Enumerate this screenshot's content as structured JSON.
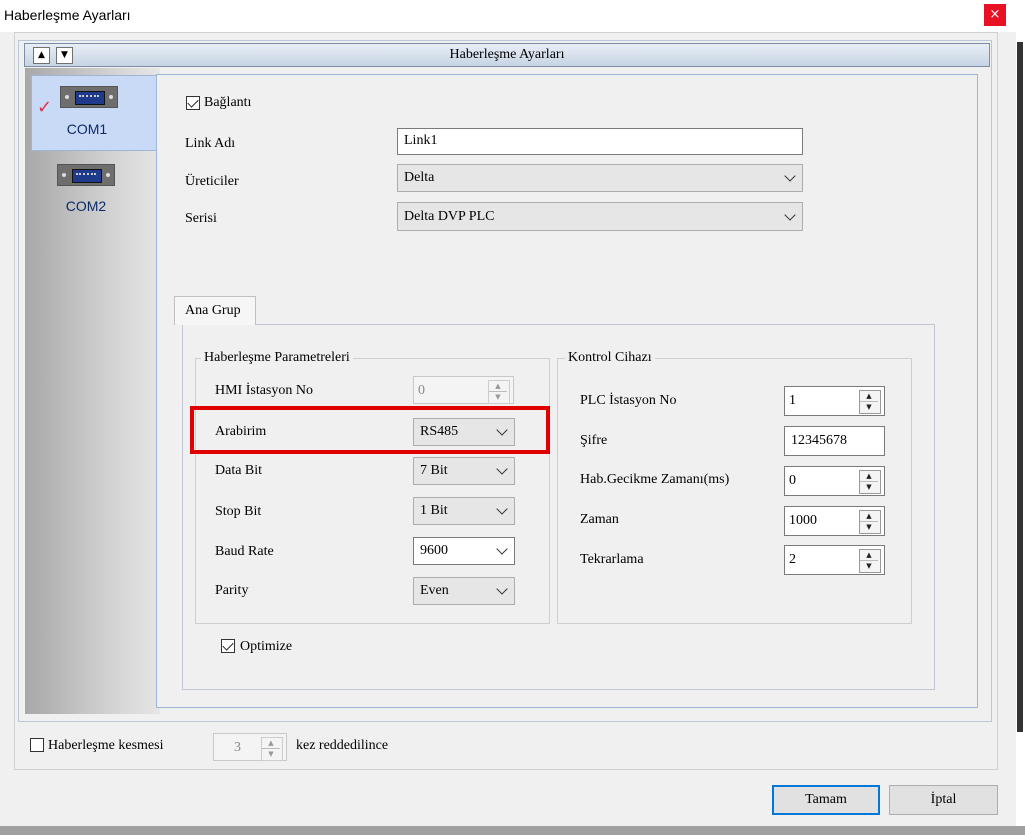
{
  "window": {
    "title": "Haberleşme Ayarları",
    "close_glyph": "×"
  },
  "header": {
    "title": "Haberleşme Ayarları",
    "up_glyph": "▲",
    "down_glyph": "▼"
  },
  "ports": [
    {
      "label": "COM1",
      "active": true,
      "check_glyph": "✓"
    },
    {
      "label": "COM2",
      "active": false
    }
  ],
  "connection": {
    "enabled_label": "Bağlantı",
    "enabled": true,
    "link_name_label": "Link Adı",
    "link_name_value": "Link1",
    "manufacturer_label": "Üreticiler",
    "manufacturer_value": "Delta",
    "series_label": "Serisi",
    "series_value": "Delta DVP PLC"
  },
  "tab": {
    "label": "Ana Grup"
  },
  "comm_params": {
    "title": "Haberleşme Parametreleri",
    "hmi_station_label": "HMI İstasyon No",
    "hmi_station_value": "0",
    "interface_label": "Arabirim",
    "interface_value": "RS485",
    "data_bit_label": "Data Bit",
    "data_bit_value": "7 Bit",
    "stop_bit_label": "Stop Bit",
    "stop_bit_value": "1 Bit",
    "baud_rate_label": "Baud Rate",
    "baud_rate_value": "9600",
    "parity_label": "Parity",
    "parity_value": "Even"
  },
  "optimize": {
    "label": "Optimize",
    "checked": true
  },
  "controller": {
    "title": "Kontrol Cihazı",
    "plc_station_label": "PLC İstasyon No",
    "plc_station_value": "1",
    "password_label": "Şifre",
    "password_value": "12345678",
    "delay_label": "Hab.Gecikme Zamanı(ms)",
    "delay_value": "0",
    "timeout_label": "Zaman",
    "timeout_value": "1000",
    "retry_label": "Tekrarlama",
    "retry_value": "2"
  },
  "disconnect": {
    "label": "Haberleşme kesmesi",
    "checked": false,
    "count_value": "3",
    "suffix": "kez reddedilince"
  },
  "buttons": {
    "ok": "Tamam",
    "cancel": "İptal"
  },
  "colors": {
    "highlight": "#e00000",
    "active_port_bg": "#c9daf6",
    "check": "#e0304a"
  }
}
